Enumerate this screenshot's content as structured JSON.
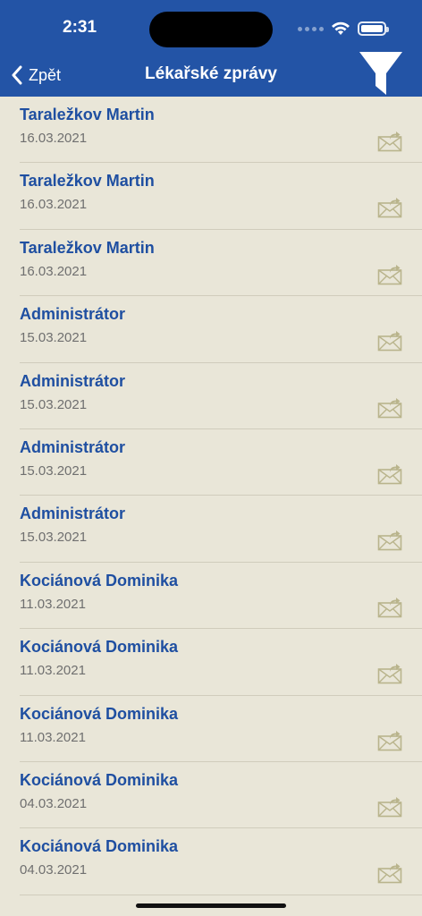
{
  "status_bar": {
    "time": "2:31"
  },
  "nav": {
    "back_label": "Zpět",
    "title": "Lékařské zprávy"
  },
  "colors": {
    "header": "#2354a6",
    "background": "#e9e6d8",
    "name_text": "#1f4fa1",
    "icon": "#b9b48c"
  },
  "messages": [
    {
      "sender": "Taraležkov Martin",
      "date": "16.03.2021",
      "icon": "envelope-forward-icon"
    },
    {
      "sender": "Taraležkov Martin",
      "date": "16.03.2021",
      "icon": "envelope-forward-icon"
    },
    {
      "sender": "Taraležkov Martin",
      "date": "16.03.2021",
      "icon": "envelope-forward-icon"
    },
    {
      "sender": "Administrátor",
      "date": "15.03.2021",
      "icon": "envelope-forward-icon"
    },
    {
      "sender": "Administrátor",
      "date": "15.03.2021",
      "icon": "envelope-forward-icon"
    },
    {
      "sender": "Administrátor",
      "date": "15.03.2021",
      "icon": "envelope-forward-icon"
    },
    {
      "sender": "Administrátor",
      "date": "15.03.2021",
      "icon": "envelope-forward-icon"
    },
    {
      "sender": "Kociánová Dominika",
      "date": "11.03.2021",
      "icon": "envelope-forward-icon"
    },
    {
      "sender": "Kociánová Dominika",
      "date": "11.03.2021",
      "icon": "envelope-forward-icon"
    },
    {
      "sender": "Kociánová Dominika",
      "date": "11.03.2021",
      "icon": "envelope-forward-icon"
    },
    {
      "sender": "Kociánová Dominika",
      "date": "04.03.2021",
      "icon": "envelope-forward-icon"
    },
    {
      "sender": "Kociánová Dominika",
      "date": "04.03.2021",
      "icon": "envelope-forward-icon"
    }
  ]
}
